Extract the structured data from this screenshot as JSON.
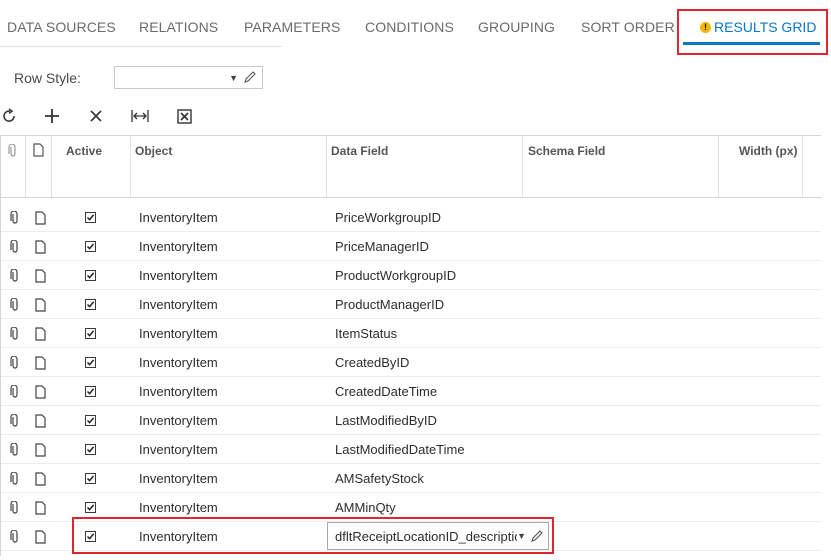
{
  "tabs": {
    "items": [
      "DATA SOURCES",
      "RELATIONS",
      "PARAMETERS",
      "CONDITIONS",
      "GROUPING",
      "SORT ORDER"
    ],
    "active": "RESULTS GRID"
  },
  "row_style": {
    "label": "Row Style:",
    "value": ""
  },
  "toolbar": [
    "refresh-icon",
    "add-icon",
    "delete-icon",
    "fit-width-icon",
    "export-excel-icon"
  ],
  "grid": {
    "columns": [
      "Active",
      "Object",
      "Data Field",
      "Schema Field",
      "Width (px)"
    ],
    "rows": [
      {
        "active": true,
        "object": "InventoryItem",
        "data_field": "PriceWorkgroupID"
      },
      {
        "active": true,
        "object": "InventoryItem",
        "data_field": "PriceManagerID"
      },
      {
        "active": true,
        "object": "InventoryItem",
        "data_field": "ProductWorkgroupID"
      },
      {
        "active": true,
        "object": "InventoryItem",
        "data_field": "ProductManagerID"
      },
      {
        "active": true,
        "object": "InventoryItem",
        "data_field": "ItemStatus"
      },
      {
        "active": true,
        "object": "InventoryItem",
        "data_field": "CreatedByID"
      },
      {
        "active": true,
        "object": "InventoryItem",
        "data_field": "CreatedDateTime"
      },
      {
        "active": true,
        "object": "InventoryItem",
        "data_field": "LastModifiedByID"
      },
      {
        "active": true,
        "object": "InventoryItem",
        "data_field": "LastModifiedDateTime"
      },
      {
        "active": true,
        "object": "InventoryItem",
        "data_field": "AMSafetyStock"
      },
      {
        "active": true,
        "object": "InventoryItem",
        "data_field": "AMMinQty"
      }
    ],
    "edit_row": {
      "active": true,
      "object": "InventoryItem",
      "data_field": "dfltReceiptLocationID_description"
    }
  },
  "colors": {
    "accent": "#0b77c7",
    "highlight": "#e0262b",
    "warning": "#f2b705"
  }
}
